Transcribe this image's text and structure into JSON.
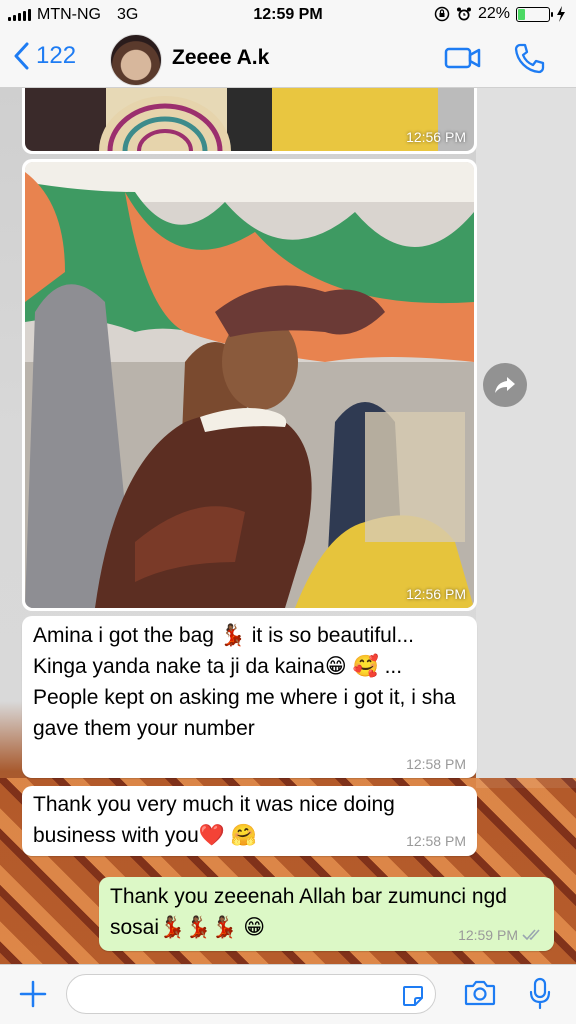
{
  "status_bar": {
    "carrier": "MTN-NG",
    "network": "3G",
    "time": "12:59 PM",
    "battery": "22%",
    "battery_level": 0.22
  },
  "header": {
    "back_count": "122",
    "contact_name": "Zeeee A.k"
  },
  "messages": [
    {
      "type": "image",
      "direction": "in",
      "time": "12:56 PM",
      "image_desc": "woven bag"
    },
    {
      "type": "image",
      "direction": "in",
      "time": "12:56 PM",
      "image_desc": "woman with bag"
    },
    {
      "type": "text",
      "direction": "in",
      "time": "12:58 PM",
      "text": "Amina i got the bag 💃🏾 it is so beautiful... Kinga yanda nake ta ji da kaina😁 🥰 ... People kept on asking me where i got it, i sha gave them your number"
    },
    {
      "type": "text",
      "direction": "in",
      "time": "12:58 PM",
      "text": "Thank you very much it was nice doing business with you❤️ 🤗"
    },
    {
      "type": "text",
      "direction": "out",
      "time": "12:59 PM",
      "text": "Thank you zeeenah Allah bar zumunci ngd sosai💃🏾💃🏾💃🏾 😁"
    }
  ],
  "colors": {
    "accent": "#1e7cf3",
    "outgoing_bubble": "#dcf8c6",
    "incoming_bubble": "#ffffff",
    "read_ticks": "#9aa6b0"
  }
}
